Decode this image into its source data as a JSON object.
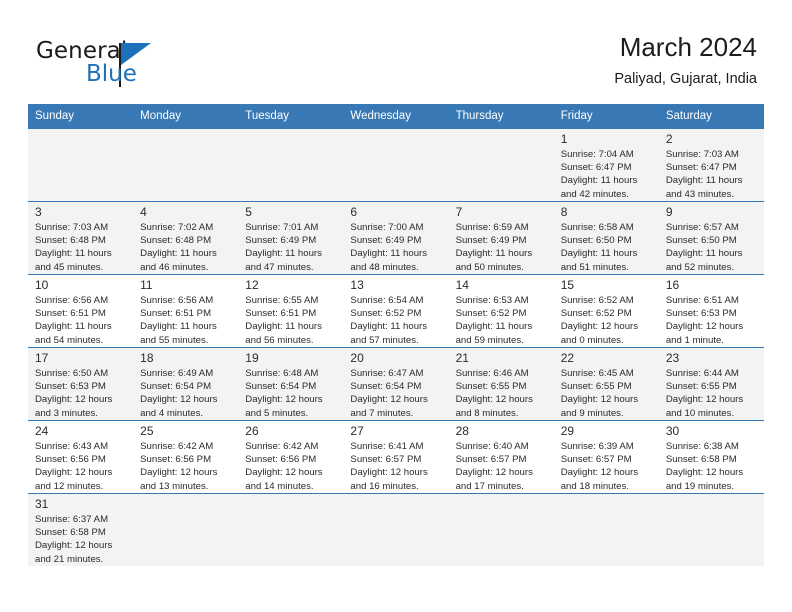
{
  "brand": {
    "name_part1": "General",
    "name_part2": "Blue",
    "logo_icon": "triangle-flag-icon"
  },
  "header": {
    "title": "March 2024",
    "subtitle": "Paliyad, Gujarat, India"
  },
  "columns": [
    "Sunday",
    "Monday",
    "Tuesday",
    "Wednesday",
    "Thursday",
    "Friday",
    "Saturday"
  ],
  "colors": {
    "header_blue": "#3878b4",
    "brand_blue": "#1d71b8",
    "row_alt": "#f3f3f3",
    "text": "#2b2b2b"
  },
  "weeks": [
    [
      {
        "empty": true
      },
      {
        "empty": true
      },
      {
        "empty": true
      },
      {
        "empty": true
      },
      {
        "empty": true
      },
      {
        "day": "1",
        "sunrise": "Sunrise: 7:04 AM",
        "sunset": "Sunset: 6:47 PM",
        "daylight_line1": "Daylight: 11 hours",
        "daylight_line2": "and 42 minutes."
      },
      {
        "day": "2",
        "sunrise": "Sunrise: 7:03 AM",
        "sunset": "Sunset: 6:47 PM",
        "daylight_line1": "Daylight: 11 hours",
        "daylight_line2": "and 43 minutes."
      }
    ],
    [
      {
        "day": "3",
        "sunrise": "Sunrise: 7:03 AM",
        "sunset": "Sunset: 6:48 PM",
        "daylight_line1": "Daylight: 11 hours",
        "daylight_line2": "and 45 minutes."
      },
      {
        "day": "4",
        "sunrise": "Sunrise: 7:02 AM",
        "sunset": "Sunset: 6:48 PM",
        "daylight_line1": "Daylight: 11 hours",
        "daylight_line2": "and 46 minutes."
      },
      {
        "day": "5",
        "sunrise": "Sunrise: 7:01 AM",
        "sunset": "Sunset: 6:49 PM",
        "daylight_line1": "Daylight: 11 hours",
        "daylight_line2": "and 47 minutes."
      },
      {
        "day": "6",
        "sunrise": "Sunrise: 7:00 AM",
        "sunset": "Sunset: 6:49 PM",
        "daylight_line1": "Daylight: 11 hours",
        "daylight_line2": "and 48 minutes."
      },
      {
        "day": "7",
        "sunrise": "Sunrise: 6:59 AM",
        "sunset": "Sunset: 6:49 PM",
        "daylight_line1": "Daylight: 11 hours",
        "daylight_line2": "and 50 minutes."
      },
      {
        "day": "8",
        "sunrise": "Sunrise: 6:58 AM",
        "sunset": "Sunset: 6:50 PM",
        "daylight_line1": "Daylight: 11 hours",
        "daylight_line2": "and 51 minutes."
      },
      {
        "day": "9",
        "sunrise": "Sunrise: 6:57 AM",
        "sunset": "Sunset: 6:50 PM",
        "daylight_line1": "Daylight: 11 hours",
        "daylight_line2": "and 52 minutes."
      }
    ],
    [
      {
        "day": "10",
        "sunrise": "Sunrise: 6:56 AM",
        "sunset": "Sunset: 6:51 PM",
        "daylight_line1": "Daylight: 11 hours",
        "daylight_line2": "and 54 minutes."
      },
      {
        "day": "11",
        "sunrise": "Sunrise: 6:56 AM",
        "sunset": "Sunset: 6:51 PM",
        "daylight_line1": "Daylight: 11 hours",
        "daylight_line2": "and 55 minutes."
      },
      {
        "day": "12",
        "sunrise": "Sunrise: 6:55 AM",
        "sunset": "Sunset: 6:51 PM",
        "daylight_line1": "Daylight: 11 hours",
        "daylight_line2": "and 56 minutes."
      },
      {
        "day": "13",
        "sunrise": "Sunrise: 6:54 AM",
        "sunset": "Sunset: 6:52 PM",
        "daylight_line1": "Daylight: 11 hours",
        "daylight_line2": "and 57 minutes."
      },
      {
        "day": "14",
        "sunrise": "Sunrise: 6:53 AM",
        "sunset": "Sunset: 6:52 PM",
        "daylight_line1": "Daylight: 11 hours",
        "daylight_line2": "and 59 minutes."
      },
      {
        "day": "15",
        "sunrise": "Sunrise: 6:52 AM",
        "sunset": "Sunset: 6:52 PM",
        "daylight_line1": "Daylight: 12 hours",
        "daylight_line2": "and 0 minutes."
      },
      {
        "day": "16",
        "sunrise": "Sunrise: 6:51 AM",
        "sunset": "Sunset: 6:53 PM",
        "daylight_line1": "Daylight: 12 hours",
        "daylight_line2": "and 1 minute."
      }
    ],
    [
      {
        "day": "17",
        "sunrise": "Sunrise: 6:50 AM",
        "sunset": "Sunset: 6:53 PM",
        "daylight_line1": "Daylight: 12 hours",
        "daylight_line2": "and 3 minutes."
      },
      {
        "day": "18",
        "sunrise": "Sunrise: 6:49 AM",
        "sunset": "Sunset: 6:54 PM",
        "daylight_line1": "Daylight: 12 hours",
        "daylight_line2": "and 4 minutes."
      },
      {
        "day": "19",
        "sunrise": "Sunrise: 6:48 AM",
        "sunset": "Sunset: 6:54 PM",
        "daylight_line1": "Daylight: 12 hours",
        "daylight_line2": "and 5 minutes."
      },
      {
        "day": "20",
        "sunrise": "Sunrise: 6:47 AM",
        "sunset": "Sunset: 6:54 PM",
        "daylight_line1": "Daylight: 12 hours",
        "daylight_line2": "and 7 minutes."
      },
      {
        "day": "21",
        "sunrise": "Sunrise: 6:46 AM",
        "sunset": "Sunset: 6:55 PM",
        "daylight_line1": "Daylight: 12 hours",
        "daylight_line2": "and 8 minutes."
      },
      {
        "day": "22",
        "sunrise": "Sunrise: 6:45 AM",
        "sunset": "Sunset: 6:55 PM",
        "daylight_line1": "Daylight: 12 hours",
        "daylight_line2": "and 9 minutes."
      },
      {
        "day": "23",
        "sunrise": "Sunrise: 6:44 AM",
        "sunset": "Sunset: 6:55 PM",
        "daylight_line1": "Daylight: 12 hours",
        "daylight_line2": "and 10 minutes."
      }
    ],
    [
      {
        "day": "24",
        "sunrise": "Sunrise: 6:43 AM",
        "sunset": "Sunset: 6:56 PM",
        "daylight_line1": "Daylight: 12 hours",
        "daylight_line2": "and 12 minutes."
      },
      {
        "day": "25",
        "sunrise": "Sunrise: 6:42 AM",
        "sunset": "Sunset: 6:56 PM",
        "daylight_line1": "Daylight: 12 hours",
        "daylight_line2": "and 13 minutes."
      },
      {
        "day": "26",
        "sunrise": "Sunrise: 6:42 AM",
        "sunset": "Sunset: 6:56 PM",
        "daylight_line1": "Daylight: 12 hours",
        "daylight_line2": "and 14 minutes."
      },
      {
        "day": "27",
        "sunrise": "Sunrise: 6:41 AM",
        "sunset": "Sunset: 6:57 PM",
        "daylight_line1": "Daylight: 12 hours",
        "daylight_line2": "and 16 minutes."
      },
      {
        "day": "28",
        "sunrise": "Sunrise: 6:40 AM",
        "sunset": "Sunset: 6:57 PM",
        "daylight_line1": "Daylight: 12 hours",
        "daylight_line2": "and 17 minutes."
      },
      {
        "day": "29",
        "sunrise": "Sunrise: 6:39 AM",
        "sunset": "Sunset: 6:57 PM",
        "daylight_line1": "Daylight: 12 hours",
        "daylight_line2": "and 18 minutes."
      },
      {
        "day": "30",
        "sunrise": "Sunrise: 6:38 AM",
        "sunset": "Sunset: 6:58 PM",
        "daylight_line1": "Daylight: 12 hours",
        "daylight_line2": "and 19 minutes."
      }
    ],
    [
      {
        "day": "31",
        "sunrise": "Sunrise: 6:37 AM",
        "sunset": "Sunset: 6:58 PM",
        "daylight_line1": "Daylight: 12 hours",
        "daylight_line2": "and 21 minutes."
      },
      {
        "empty": true
      },
      {
        "empty": true
      },
      {
        "empty": true
      },
      {
        "empty": true
      },
      {
        "empty": true
      },
      {
        "empty": true
      }
    ]
  ]
}
